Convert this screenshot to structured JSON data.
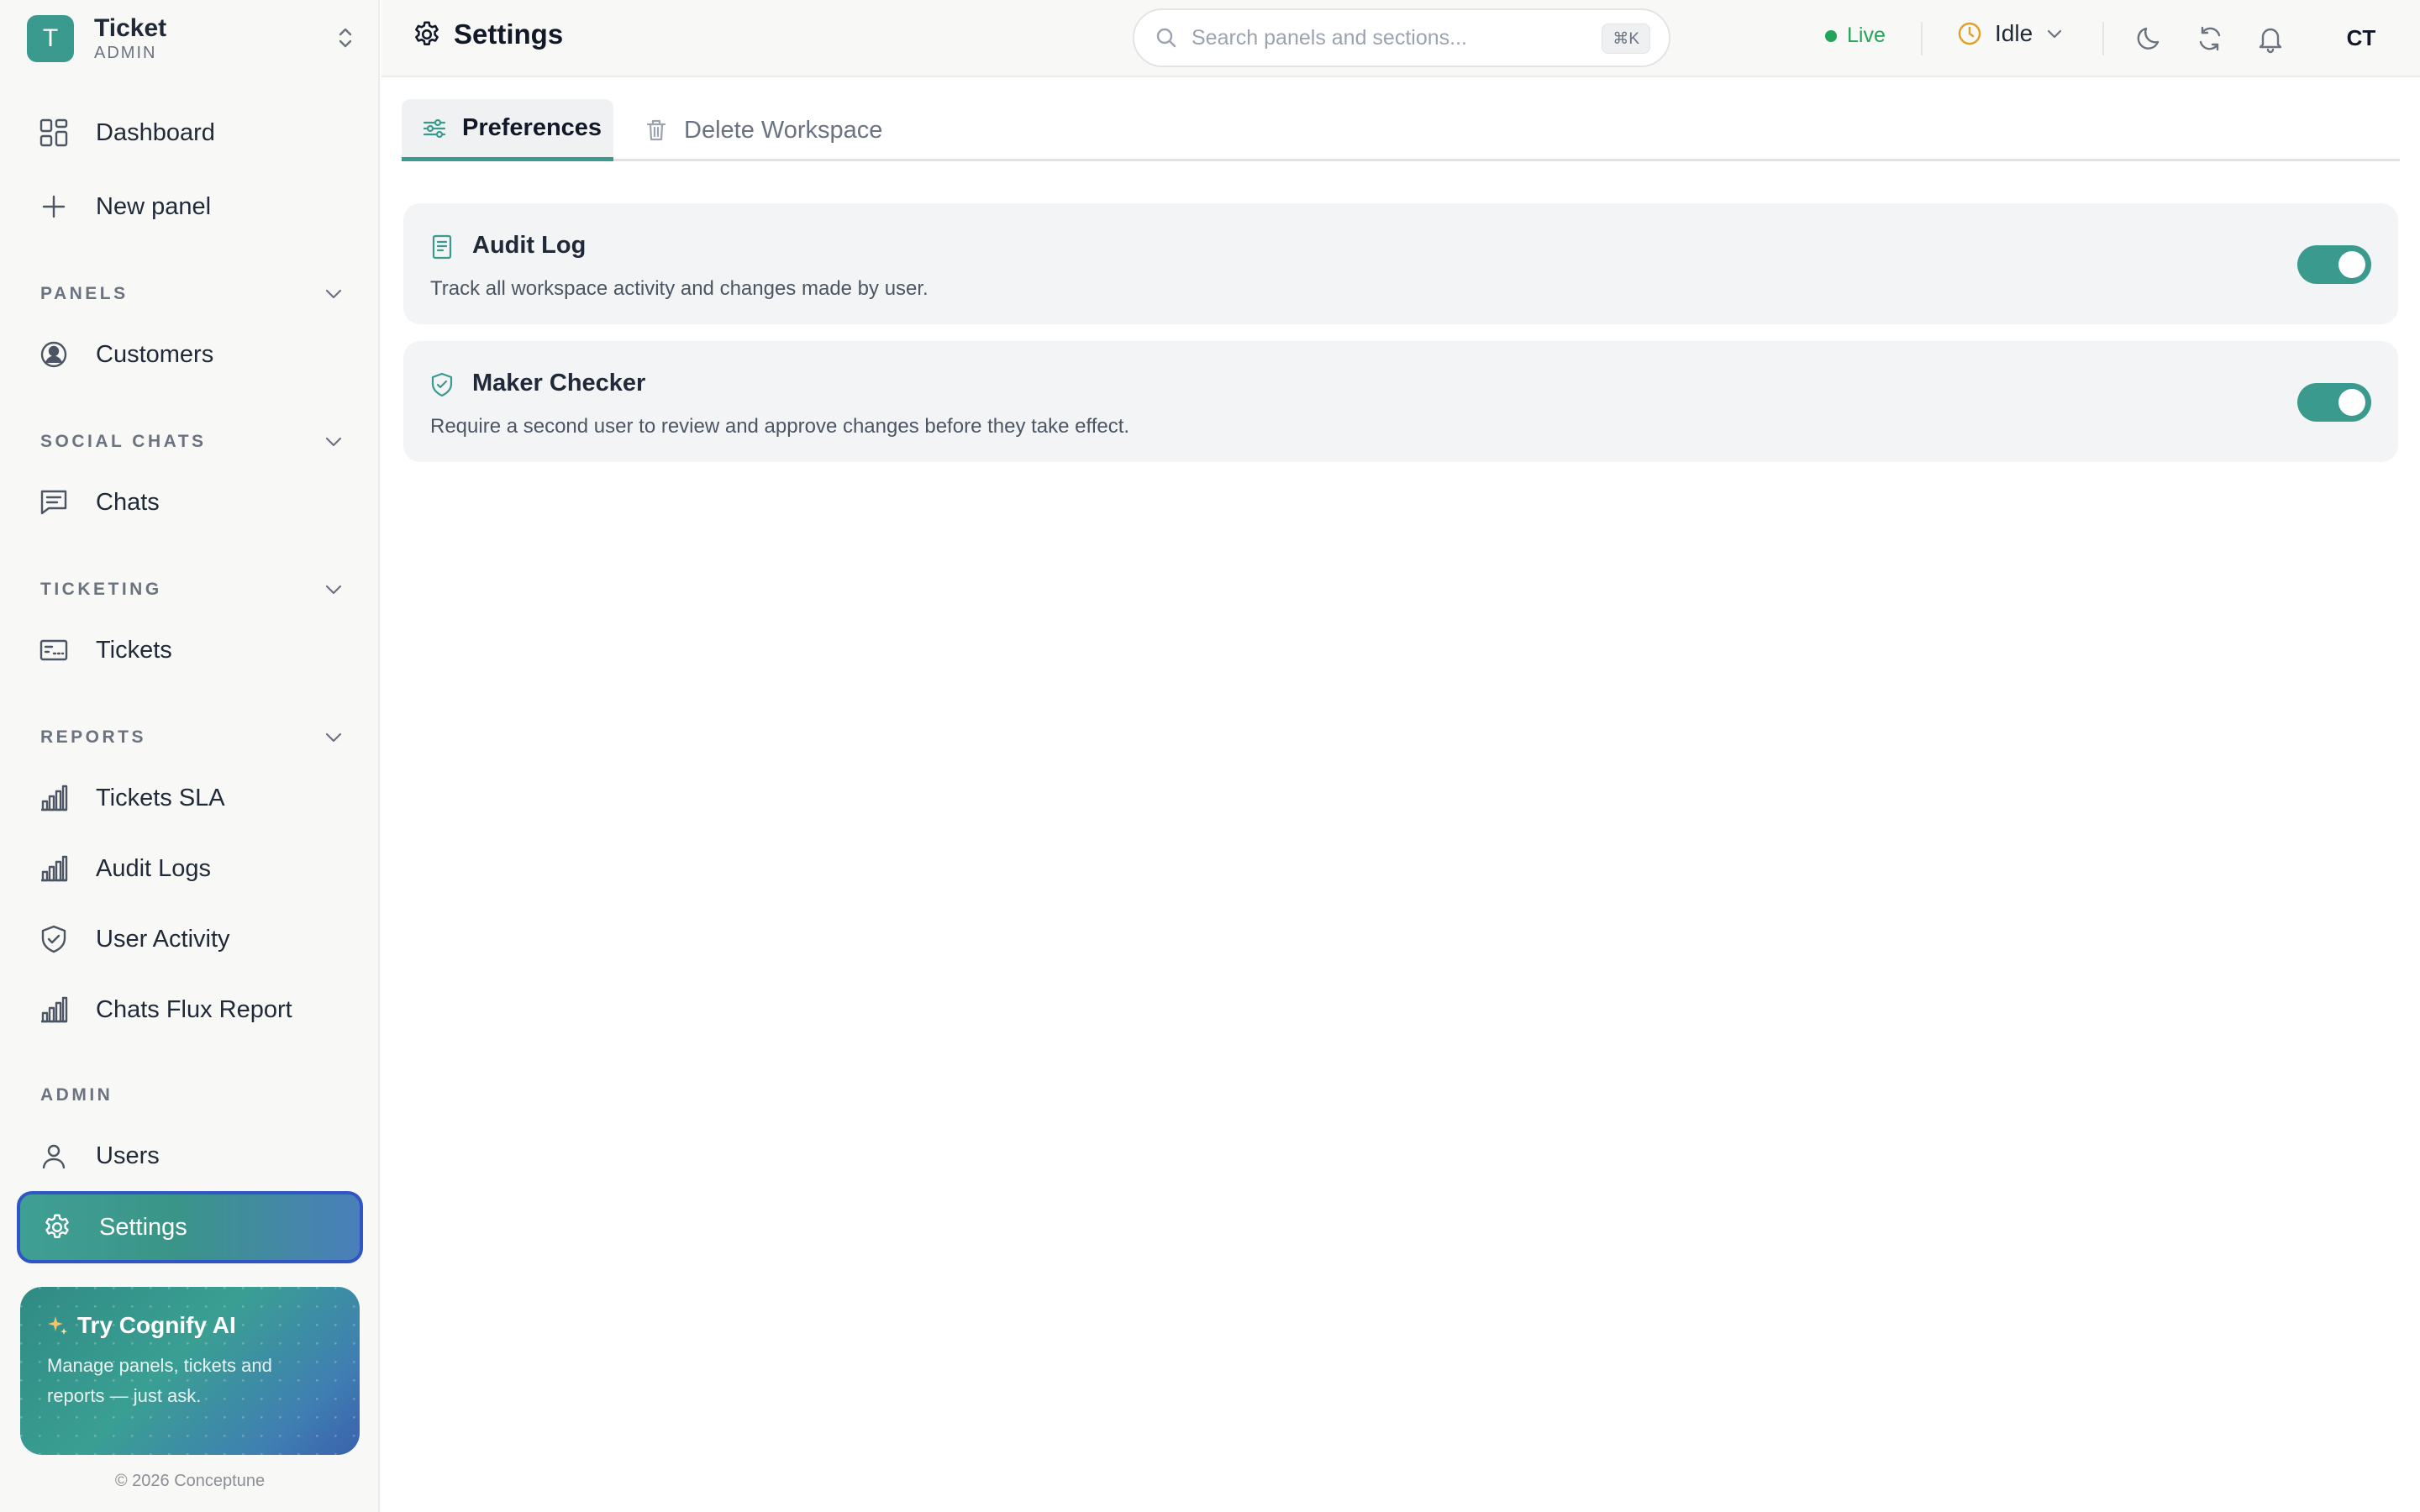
{
  "brand": {
    "logo_letter": "T",
    "name": "Ticket",
    "role": "ADMIN"
  },
  "sidebar": {
    "top_items": [
      {
        "label": "Dashboard",
        "icon": "dashboard-icon"
      },
      {
        "label": "New panel",
        "icon": "plus-icon"
      }
    ],
    "sections": [
      {
        "title": "PANELS",
        "items": [
          {
            "label": "Customers",
            "icon": "user-circle-icon"
          }
        ]
      },
      {
        "title": "SOCIAL CHATS",
        "items": [
          {
            "label": "Chats",
            "icon": "chat-icon"
          }
        ]
      },
      {
        "title": "TICKETING",
        "items": [
          {
            "label": "Tickets",
            "icon": "ticket-icon"
          }
        ]
      },
      {
        "title": "REPORTS",
        "items": [
          {
            "label": "Tickets SLA",
            "icon": "bar-chart-icon"
          },
          {
            "label": "Audit Logs",
            "icon": "bar-chart-icon"
          },
          {
            "label": "User Activity",
            "icon": "shield-check-icon"
          },
          {
            "label": "Chats Flux Report",
            "icon": "bar-chart-icon"
          }
        ]
      },
      {
        "title": "ADMIN",
        "items": [
          {
            "label": "Users",
            "icon": "user-icon"
          },
          {
            "label": "Settings",
            "icon": "gear-icon",
            "active": true
          }
        ]
      }
    ]
  },
  "promo": {
    "title": "Try Cognify AI",
    "description": "Manage panels, tickets and reports — just ask."
  },
  "footer": {
    "copyright": "© 2026 Conceptune"
  },
  "header": {
    "title": "Settings",
    "search_placeholder": "Search panels and sections...",
    "search_shortcut": "⌘K",
    "live_label": "Live",
    "status_label": "Idle",
    "avatar_initials": "CT"
  },
  "tabs": [
    {
      "label": "Preferences",
      "icon": "sliders-icon",
      "active": true
    },
    {
      "label": "Delete Workspace",
      "icon": "trash-icon",
      "active": false
    }
  ],
  "settings": [
    {
      "title": "Audit Log",
      "description": "Track all workspace activity and changes made by user.",
      "icon": "document-list-icon",
      "enabled": true
    },
    {
      "title": "Maker Checker",
      "description": "Require a second user to review and approve changes before they take effect.",
      "icon": "shield-check-icon",
      "enabled": true
    }
  ],
  "colors": {
    "accent": "#3a9a8e",
    "live": "#22a55a",
    "status_idle": "#e0a128",
    "active_border": "#2f56c4"
  }
}
